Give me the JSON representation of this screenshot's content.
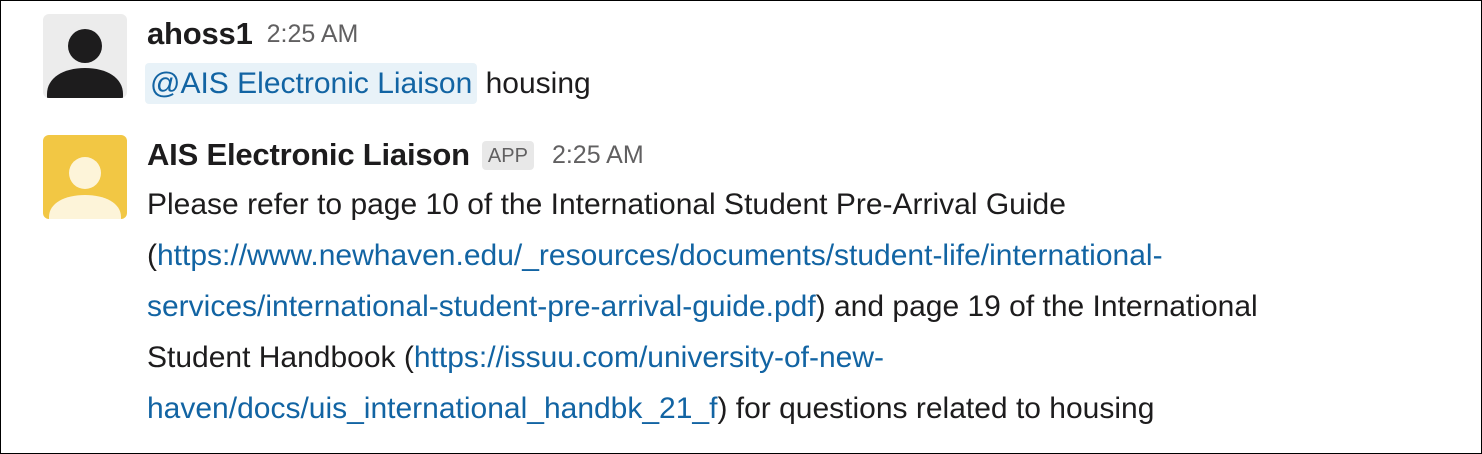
{
  "messages": [
    {
      "sender": "ahoss1",
      "time": "2:25 AM",
      "avatar": "default-user-avatar",
      "avatar_bg": "#ececec",
      "avatar_fg": "#1d1c1d",
      "mention": "@AIS Electronic Liaison",
      "text": " housing"
    },
    {
      "sender": "AIS Electronic Liaison",
      "badge": "APP",
      "time": "2:25 AM",
      "avatar": "app-avatar",
      "avatar_bg": "#f2c744",
      "avatar_fg": "#fdf4d9",
      "lines": {
        "l1": "Please refer to page 10 of the International Student Pre-Arrival Guide",
        "l2_pre": "(",
        "link1_part1": "https://www.newhaven.edu/_resources/documents/student-life/international-",
        "link1_part2": "services/international-student-pre-arrival-guide.pdf",
        "l3_post": ") and page 19 of the International",
        "l4_pre": "Student Handbook (",
        "link2_part1": "https://issuu.com/university-of-new-",
        "link2_part2": "haven/docs/uis_international_handbk_21_f",
        "l5_post": ") for questions related to housing"
      }
    }
  ],
  "colors": {
    "link": "#1264a3",
    "mention_bg": "#e8f2f8",
    "text": "#1d1c1d",
    "muted": "#616061"
  }
}
